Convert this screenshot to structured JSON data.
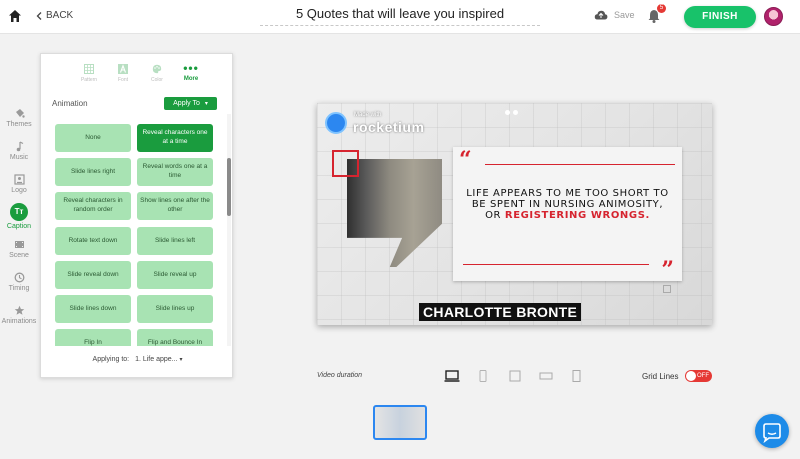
{
  "header": {
    "back_label": "BACK",
    "title": "5 Quotes that will leave you inspired",
    "save_label": "Save",
    "notification_count": "5",
    "finish_label": "FINISH"
  },
  "sidebar": {
    "items": [
      {
        "label": "Themes",
        "icon": "paint-bucket-icon"
      },
      {
        "label": "Music",
        "icon": "music-note-icon"
      },
      {
        "label": "Logo",
        "icon": "logo-icon"
      },
      {
        "label": "Caption",
        "icon": "text-icon",
        "icon_text": "Tт"
      },
      {
        "label": "Scene",
        "icon": "film-icon"
      },
      {
        "label": "Timing",
        "icon": "clock-icon"
      },
      {
        "label": "Animations",
        "icon": "star-icon"
      }
    ]
  },
  "panel": {
    "tabs": [
      {
        "label": "Pattern",
        "icon": "grid-icon"
      },
      {
        "label": "Font",
        "icon": "font-icon"
      },
      {
        "label": "Color",
        "icon": "palette-icon"
      },
      {
        "label": "More",
        "icon": "dots-icon",
        "icon_text": "•••"
      }
    ],
    "section_label": "Animation",
    "apply_button": "Apply To",
    "options": [
      {
        "label": "None",
        "selected": false
      },
      {
        "label": "Reveal characters one at a time",
        "selected": true
      },
      {
        "label": "Slide lines right",
        "selected": false
      },
      {
        "label": "Reveal words one at a time",
        "selected": false
      },
      {
        "label": "Reveal characters in random order",
        "selected": false
      },
      {
        "label": "Show lines one after the other",
        "selected": false
      },
      {
        "label": "Rotate text down",
        "selected": false
      },
      {
        "label": "Slide lines left",
        "selected": false
      },
      {
        "label": "Slide reveal down",
        "selected": false
      },
      {
        "label": "Slide reveal up",
        "selected": false
      },
      {
        "label": "Slide lines down",
        "selected": false
      },
      {
        "label": "Slide lines up",
        "selected": false
      },
      {
        "label": "Flip In",
        "selected": false
      },
      {
        "label": "Flip and Bounce In",
        "selected": false
      }
    ],
    "applying_to_label": "Applying to:",
    "applying_to_value": "1. Life appe..."
  },
  "canvas": {
    "logo_small": "Made with",
    "logo_big": "rocketium",
    "quote_plain": "Life appears to me too short to be spent in nursing animosity, or ",
    "quote_highlight": "registering wrongs.",
    "open_quote": "“",
    "close_quote": "”",
    "author": "CHARLOTTE BRONTE"
  },
  "bottom": {
    "video_duration_label": "Video duration",
    "grid_lines_label": "Grid Lines",
    "grid_lines_state": "OFF"
  },
  "colors": {
    "accent_green": "#1a9c3e",
    "finish_green": "#18c26a",
    "quote_red": "#d6242f",
    "toggle_red": "#e53935",
    "brand_blue": "#1d8be8"
  }
}
